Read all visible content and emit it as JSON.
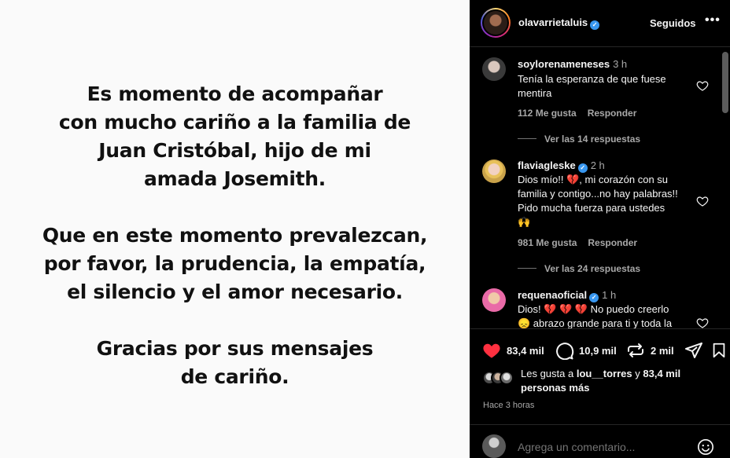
{
  "post_image": {
    "paragraphs": [
      [
        "Es momento de acompañar",
        "con mucho cariño a la familia de",
        "Juan Cristóbal, hijo de mi",
        "amada Josemith."
      ],
      [
        "Que en este momento prevalezcan,",
        "por favor, la prudencia, la empatía,",
        "el silencio y el amor necesario."
      ],
      [
        "Gracias por sus mensajes",
        "de cariño."
      ]
    ]
  },
  "header": {
    "username": "olavarrietaluis",
    "verified": true,
    "following_label": "Seguidos",
    "more_icon": "more-horizontal-icon"
  },
  "comments": [
    {
      "username": "soylorenameneses",
      "verified": false,
      "time": "3 h",
      "text_lines": [
        "Tenía la esperanza de que fuese",
        "mentira"
      ],
      "likes": "112 Me gusta",
      "reply_label": "Responder",
      "view_replies": "Ver las 14 respuestas"
    },
    {
      "username": "flaviagleske",
      "verified": true,
      "time": "2 h",
      "text_lines": [
        "Dios mío!! 💔, mi corazón con su",
        "familia y contigo...no hay palabras!!",
        "Pido mucha fuerza para ustedes",
        "🙌"
      ],
      "likes": "981 Me gusta",
      "reply_label": "Responder",
      "view_replies": "Ver las 24 respuestas"
    },
    {
      "username": "requenaoficial",
      "verified": true,
      "time": "1 h",
      "text_lines": [
        "Dios! 💔 💔 💔  No puedo creerlo",
        "😞 abrazo grande para ti y toda la"
      ]
    }
  ],
  "actions": {
    "likes_count": "83,4 mil",
    "comments_count": "10,9 mil",
    "reposts_count": "2 mil",
    "like_color": "#ff3040"
  },
  "likes_summary": {
    "prefix": "Les gusta a ",
    "user": "lou__torres",
    "middle": " y ",
    "count": "83,4 mil",
    "suffix": "personas más"
  },
  "time_ago": "Hace 3 horas",
  "comment_box": {
    "placeholder": "Agrega un comentario..."
  }
}
